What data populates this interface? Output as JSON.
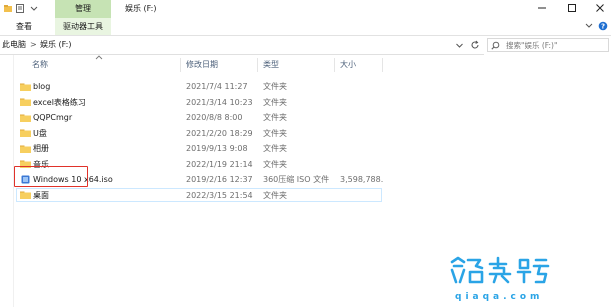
{
  "ribbon": {
    "context_tab": "管理",
    "window_title": "娱乐 (F:)",
    "tabs": {
      "home": "查看",
      "drive_tools": "驱动器工具"
    }
  },
  "address": {
    "root": "此电脑",
    "separator": ">",
    "current": "娱乐 (F:)",
    "search_placeholder": "搜索\"娱乐 (F:)\""
  },
  "columns": {
    "name": "名称",
    "date": "修改日期",
    "type": "类型",
    "size": "大小"
  },
  "files": [
    {
      "name": "blog",
      "date": "2021/7/4 11:27",
      "type": "文件夹",
      "size": "",
      "icon": "folder-icon"
    },
    {
      "name": "excel表格练习",
      "date": "2021/3/14 10:23",
      "type": "文件夹",
      "size": "",
      "icon": "folder-icon"
    },
    {
      "name": "QQPCmgr",
      "date": "2020/8/8 8:00",
      "type": "文件夹",
      "size": "",
      "icon": "folder-icon"
    },
    {
      "name": "U盘",
      "date": "2021/2/20 18:29",
      "type": "文件夹",
      "size": "",
      "icon": "folder-icon"
    },
    {
      "name": "相册",
      "date": "2019/9/13 9:08",
      "type": "文件夹",
      "size": "",
      "icon": "folder-icon"
    },
    {
      "name": "音乐",
      "date": "2022/1/19 21:14",
      "type": "文件夹",
      "size": "",
      "icon": "folder-icon"
    },
    {
      "name": "Windows 10 x64.iso",
      "date": "2019/2/16 12:37",
      "type": "360压缩 ISO 文件",
      "size": "3,598,788...",
      "icon": "iso-file-icon"
    },
    {
      "name": "桌面",
      "date": "2022/3/15 21:54",
      "type": "文件夹",
      "size": "",
      "icon": "folder-icon"
    }
  ],
  "watermark": {
    "sub": "qiaqa.com"
  },
  "colors": {
    "context_tab_bg": "#c6e3b4",
    "folder": "#f7cf5f",
    "highlight_box": "#e0322a",
    "watermark": "#2aa4e6"
  }
}
